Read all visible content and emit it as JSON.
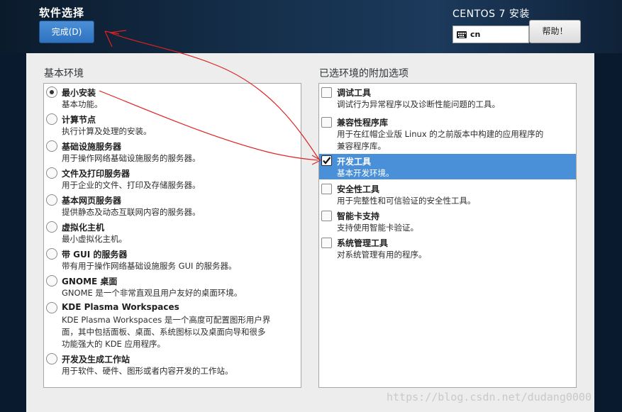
{
  "header": {
    "title": "软件选择",
    "done_label": "完成(D)",
    "product": "CENTOS 7 安装",
    "keyboard_layout": "cn",
    "help_label": "帮助！"
  },
  "base_env": {
    "label": "基本环境",
    "items": [
      {
        "title": "最小安装",
        "desc": "基本功能。",
        "selected": true
      },
      {
        "title": "计算节点",
        "desc": "执行计算及处理的安装。",
        "selected": false
      },
      {
        "title": "基础设施服务器",
        "desc": "用于操作网络基础设施服务的服务器。",
        "selected": false
      },
      {
        "title": "文件及打印服务器",
        "desc": "用于企业的文件、打印及存储服务器。",
        "selected": false
      },
      {
        "title": "基本网页服务器",
        "desc": "提供静态及动态互联网内容的服务器。",
        "selected": false
      },
      {
        "title": "虚拟化主机",
        "desc": "最小虚拟化主机。",
        "selected": false
      },
      {
        "title": "带 GUI 的服务器",
        "desc": "带有用于操作网络基础设施服务 GUI 的服务器。",
        "selected": false
      },
      {
        "title": "GNOME 桌面",
        "desc": "GNOME 是一个非常直观且用户友好的桌面环境。",
        "selected": false
      },
      {
        "title": "KDE Plasma Workspaces",
        "desc_lines": [
          "KDE Plasma Workspaces 是一个高度可配置图形用户界",
          "面，其中包括面板、桌面、系统图标以及桌面向导和很多",
          "功能强大的 KDE 应用程序。"
        ],
        "selected": false
      },
      {
        "title": "开发及生成工作站",
        "desc": "用于软件、硬件、图形或者内容开发的工作站。",
        "selected": false
      }
    ]
  },
  "addons": {
    "label": "已选环境的附加选项",
    "items": [
      {
        "title": "调试工具",
        "desc": "调试行为异常程序以及诊断性能问题的工具。",
        "checked": false
      },
      {
        "title": "兼容性程序库",
        "desc_lines": [
          "用于在红帽企业版 Linux 的之前版本中构建的应用程序的",
          "兼容程序库。"
        ],
        "checked": false
      },
      {
        "title": "开发工具",
        "desc": "基本开发环境。",
        "checked": true
      },
      {
        "title": "安全性工具",
        "desc": "用于完整性和可信验证的安全性工具。",
        "checked": false
      },
      {
        "title": "智能卡支持",
        "desc": "支持使用智能卡验证。",
        "checked": false
      },
      {
        "title": "系统管理工具",
        "desc": "对系统管理有用的程序。",
        "checked": false
      }
    ]
  },
  "watermark": "https://blog.csdn.net/dudang0000",
  "colors": {
    "selection": "#4a90d9",
    "annotation": "#e02020",
    "primary_button": "#3a7fcc"
  },
  "icons": {
    "keyboard": "keyboard-icon",
    "radio": "radio-button",
    "checkbox": "checkbox"
  }
}
